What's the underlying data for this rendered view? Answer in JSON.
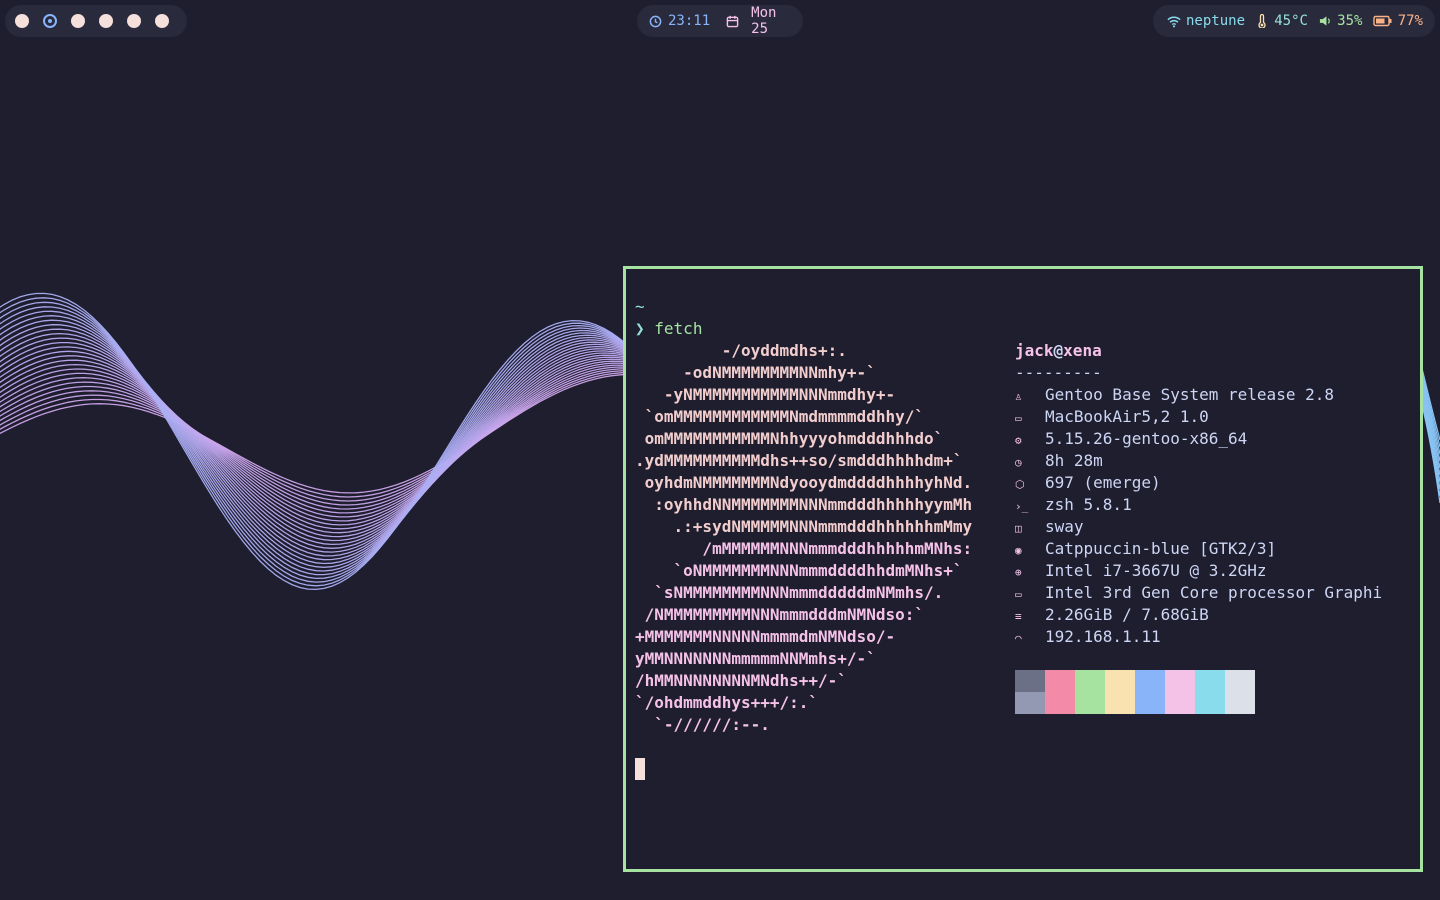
{
  "colors": {
    "bg": "#1e1e2e",
    "border": "#a6e3a1",
    "pink": "#f5c2e7",
    "blue": "#89b4fa",
    "teal": "#94e2d5",
    "text": "#cdd6f4"
  },
  "bar": {
    "workspaces": [
      {
        "active": false
      },
      {
        "active": true
      },
      {
        "active": false
      },
      {
        "active": false
      },
      {
        "active": false
      },
      {
        "active": false
      }
    ],
    "clock": {
      "icon": "clock-icon",
      "time": "23:11",
      "date_icon": "calendar-icon",
      "date": "Mon 25"
    },
    "status": {
      "wifi_icon": "wifi-icon",
      "network": "neptune",
      "temp_icon": "thermometer-icon",
      "temp": "45°C",
      "volume_icon": "volume-icon",
      "volume": "35%",
      "battery_icon": "battery-icon",
      "battery": "77%"
    }
  },
  "terminal": {
    "cwd": "~",
    "prompt": "❯",
    "command": "fetch",
    "logo": [
      "         -/oyddmdhs+:.",
      "     -odNMMMMMMMMNNmhy+-`",
      "   -yNMMMMMMMMMMMNNNmmdhy+-",
      " `omMMMMMMMMMMMMNmdmmmmddhhy/`",
      " omMMMMMMMMMMMNhhyyyohmdddhhhdo`",
      ".ydMMMMMMMMMMdhs++so/smdddhhhhdm+`",
      " oyhdmNMMMMMMMNdyooydmddddhhhhyhNd.",
      "  :oyhhdNNMMMMMMMNNNmmdddhhhhhyymMh",
      "    .:+sydNMMMMMNNNmmmdddhhhhhhmMmy",
      "       /mMMMMMMNNNmmmdddhhhhhmMNhs:",
      "    `oNMMMMMMMNNNmmmddddhhdmMNhs+`",
      "  `sNMMMMMMMMNNNmmmdddddmNMmhs/.",
      " /NMMMMMMMMMNNNmmmdddmNMNdso:`",
      "+MMMMMMMNNNNNmmmmdmNMNdso/-",
      "yMMNNNNNNNmmmmmNNMmhs+/-`",
      "/hMMNNNNNNNNMNdhs++/-`",
      "`/ohdmmddhys+++/:.`",
      "  `-//////:--."
    ],
    "user": "jack",
    "at": "@",
    "host": "xena",
    "separator": "---------",
    "info": [
      {
        "icon": "gentoo-icon",
        "glyph": "♙",
        "value": "Gentoo Base System release 2.8"
      },
      {
        "icon": "laptop-icon",
        "glyph": "▭",
        "value": "MacBookAir5,2 1.0"
      },
      {
        "icon": "kernel-icon",
        "glyph": "⚙",
        "value": "5.15.26-gentoo-x86_64"
      },
      {
        "icon": "uptime-icon",
        "glyph": "◷",
        "value": "8h 28m"
      },
      {
        "icon": "package-icon",
        "glyph": "⬡",
        "value": "697 (emerge)"
      },
      {
        "icon": "shell-icon",
        "glyph": "›_",
        "value": "zsh 5.8.1"
      },
      {
        "icon": "window-manager-icon",
        "glyph": "◫",
        "value": "sway"
      },
      {
        "icon": "palette-icon",
        "glyph": "◉",
        "value": "Catppuccin-blue [GTK2/3]"
      },
      {
        "icon": "cpu-icon",
        "glyph": "⊕",
        "value": "Intel i7-3667U @ 3.2GHz"
      },
      {
        "icon": "gpu-icon",
        "glyph": "▭",
        "value": "Intel 3rd Gen Core processor Graphi"
      },
      {
        "icon": "memory-icon",
        "glyph": "≡",
        "value": "2.26GiB / 7.68GiB"
      },
      {
        "icon": "network-icon",
        "glyph": "◠",
        "value": "192.168.1.11"
      }
    ],
    "palette_top": [
      "#6c7086",
      "#f38ba8",
      "#a6e3a1",
      "#f9e2af",
      "#89b4fa",
      "#f5c2e7",
      "#89dceb",
      "#dce0e8"
    ],
    "palette_bottom": [
      "#9399b2",
      "#f38ba8",
      "#a6e3a1",
      "#f9e2af",
      "#89b4fa",
      "#f5c2e7",
      "#89dceb",
      "#dce0e8"
    ]
  }
}
